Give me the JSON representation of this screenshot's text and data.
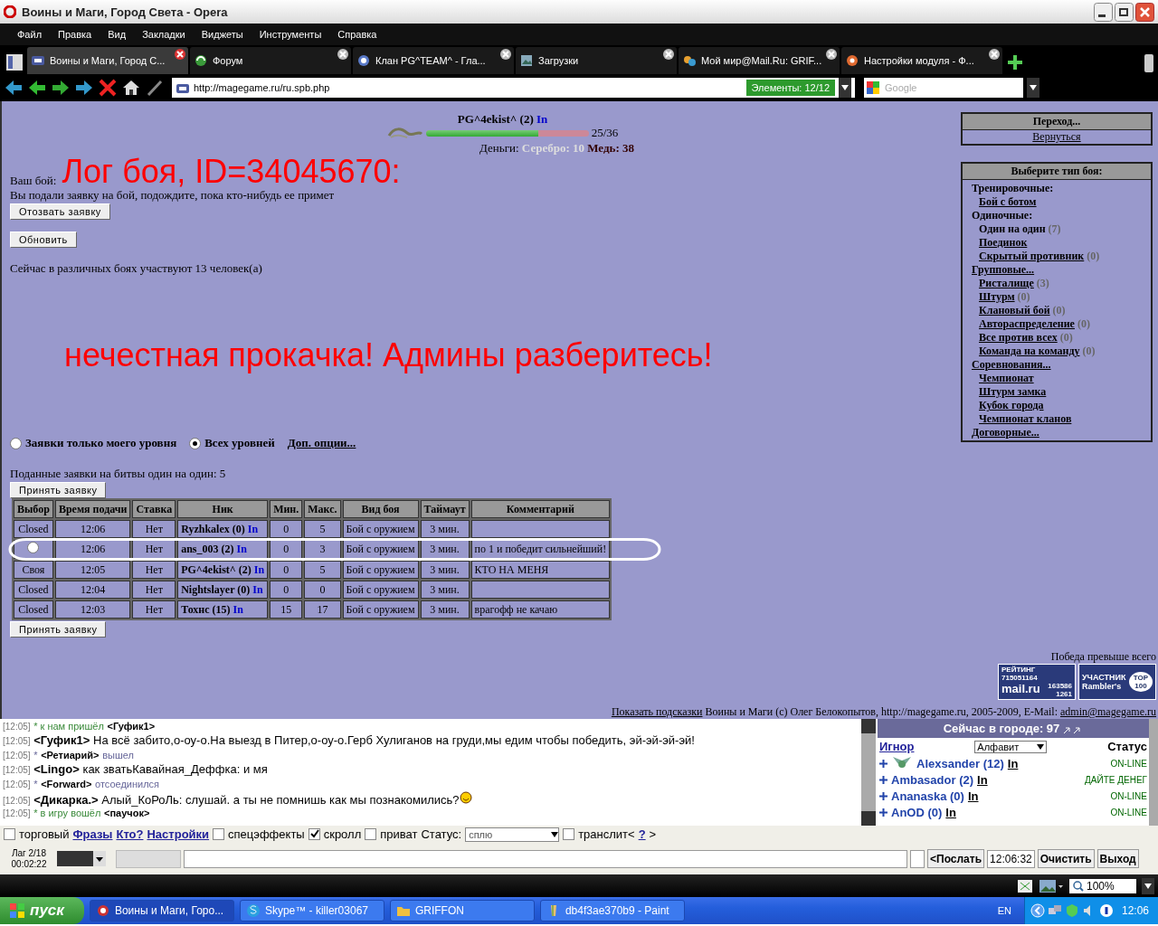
{
  "window": {
    "title": "Воины и Маги, Город Света - Opera"
  },
  "menu": [
    "Файл",
    "Правка",
    "Вид",
    "Закладки",
    "Виджеты",
    "Инструменты",
    "Справка"
  ],
  "tabs": [
    {
      "label": "Воины и Маги, Город С...",
      "selected": true
    },
    {
      "label": "Форум",
      "selected": false
    },
    {
      "label": "Клан PG^TEAM^ - Гла...",
      "selected": false
    },
    {
      "label": "Загрузки",
      "selected": false
    },
    {
      "label": "Мой мир@Mail.Ru: GRIF...",
      "selected": false
    },
    {
      "label": "Настройки модуля - Ф...",
      "selected": false
    }
  ],
  "address_bar": {
    "url": "http://magegame.ru/ru.spb.php",
    "elements": "Элементы:  12/12",
    "search_placeholder": "Google"
  },
  "game": {
    "player": {
      "name": "PG^4ekist^ (2)",
      "info_link": "In",
      "hp": {
        "level": 0.69,
        "reading": "25/36"
      },
      "money_label": "Деньги:",
      "silver": "Серебро: 10",
      "copper": "Медь: 38"
    },
    "your_fight_label": "Ваш бой:",
    "status": "Вы подали заявку на бой, подождите, пока кто-нибудь ее примет",
    "withdraw_button": "Отозвать заявку",
    "refresh_button": "Обновить",
    "participants": "Сейчас в различных боях участвуют 13 человек(а)",
    "annotations": [
      "Лог боя, ID=34045670:",
      "нечестная прокачка! Админы разберитесь!"
    ],
    "filters": [
      {
        "label": "Заявки только моего уровня",
        "selected": false
      },
      {
        "label": "Всех уровней",
        "selected": true
      }
    ],
    "options_link": "Доп. опции...",
    "requests_count": "Поданные заявки на битвы один на один: 5",
    "accept_buttons": [
      "Принять заявку",
      "Принять заявку"
    ],
    "table": {
      "columns": [
        "Выбор",
        "Время подачи",
        "Ставка",
        "Ник",
        "Мин.",
        "Макс.",
        "Вид боя",
        "Таймаут",
        "Комментарий"
      ],
      "rows": [
        {
          "choice": {
            "kind": "text",
            "text": "Closed"
          },
          "time": "12:06",
          "stake": "Нет",
          "nick": "Ryzhkalex (0)",
          "info": "In",
          "min": "0",
          "max": "5",
          "type": "Бой с оружием",
          "timeout": "3 мин.",
          "comment": ""
        },
        {
          "choice": {
            "kind": "radio",
            "selected": false
          },
          "time": "12:06",
          "stake": "Нет",
          "nick": "ans_003 (2)",
          "info": "In",
          "min": "0",
          "max": "3",
          "type": "Бой с оружием",
          "timeout": "3 мин.",
          "comment": "по 1 и победит сильнейший!"
        },
        {
          "choice": {
            "kind": "text",
            "text": "Своя"
          },
          "time": "12:05",
          "stake": "Нет",
          "nick": "PG^4ekist^ (2)",
          "info": "In",
          "min": "0",
          "max": "5",
          "type": "Бой с оружием",
          "timeout": "3 мин.",
          "comment": "КТО НА МЕНЯ"
        },
        {
          "choice": {
            "kind": "text",
            "text": "Closed"
          },
          "time": "12:04",
          "stake": "Нет",
          "nick": "Nightslayer (0)",
          "info": "In",
          "min": "0",
          "max": "0",
          "type": "Бой с оружием",
          "timeout": "3 мин.",
          "comment": ""
        },
        {
          "choice": {
            "kind": "text",
            "text": "Closed"
          },
          "time": "12:03",
          "stake": "Нет",
          "nick": "Тохнс (15)",
          "info": "In",
          "min": "15",
          "max": "17",
          "type": "Бой с оружием",
          "timeout": "3 мин.",
          "comment": "врагофф не качаю"
        }
      ]
    },
    "nav": {
      "title": "Переход...",
      "link": "Вернуться"
    },
    "fight_types": {
      "title": "Выберите тип боя:",
      "items": [
        {
          "label": "Тренировочные:",
          "kind": "text",
          "children": [
            {
              "label": "Бой с ботом",
              "kind": "link"
            }
          ]
        },
        {
          "label": "Одиночные:",
          "kind": "text",
          "children": [
            {
              "label": "Один на один",
              "kind": "text",
              "count": "(7)"
            },
            {
              "label": "Поединок",
              "kind": "link"
            },
            {
              "label": "Скрытый противник",
              "kind": "link",
              "count": "(0)"
            }
          ]
        },
        {
          "label": "Групповые...",
          "kind": "link",
          "children": [
            {
              "label": "Ристалище",
              "kind": "link",
              "count": "(3)"
            },
            {
              "label": "Штурм",
              "kind": "link",
              "count": "(0)"
            },
            {
              "label": "Клановый бой",
              "kind": "link",
              "count": "(0)"
            },
            {
              "label": "Автораспределение",
              "kind": "link",
              "count": "(0)"
            },
            {
              "label": "Все против всех",
              "kind": "link",
              "count": "(0)"
            },
            {
              "label": "Команда на команду",
              "kind": "link",
              "count": "(0)"
            }
          ]
        },
        {
          "label": "Соревнования...",
          "kind": "link",
          "children": [
            {
              "label": "Чемпионат",
              "kind": "link"
            },
            {
              "label": "Штурм замка",
              "kind": "link"
            },
            {
              "label": "Кубок города",
              "kind": "link"
            },
            {
              "label": "Чемпионат кланов",
              "kind": "link"
            }
          ]
        },
        {
          "label": "Договорные...",
          "kind": "link"
        }
      ]
    },
    "motto": "Победа превыше всего",
    "counters": {
      "rating_label": "РЕЙТИНГ",
      "rating_numbers": [
        "715051164",
        "163586",
        "1261"
      ],
      "rating_brand": "mail.ru",
      "top_label": "УЧАСТНИК",
      "top_brand": "Rambler's",
      "top_number": "TOP 100"
    },
    "footer": {
      "hints_link": "Показать подсказки",
      "copyright": "Воины и Маги (c) Олег Белокопытов, http://magegame.ru, 2005-2009, E-Mail:",
      "email": "admin@magegame.ru"
    }
  },
  "chat": {
    "messages": [
      {
        "time": "[12:05]",
        "kind": "join",
        "before": "* к нам пришёл",
        "nick": "<Гуфик1>"
      },
      {
        "time": "[12:05]",
        "kind": "say",
        "nick": "<Гуфик1>",
        "text": "На всё забито,о-оу-о.На выезд в Питер,о-оу-о.Герб Хулиганов на груди,мы едим чтобы победить, эй-эй-эй-эй!"
      },
      {
        "time": "[12:05]",
        "kind": "leave",
        "before": "*",
        "nick": "<Ретиарий>",
        "after": "вышел"
      },
      {
        "time": "[12:05]",
        "kind": "say",
        "nick": "<Lingo>",
        "text": "как зватьКавайная_Деффка: и мя"
      },
      {
        "time": "[12:05]",
        "kind": "leave",
        "before": "*",
        "nick": "<Forward>",
        "after": "отсоединился"
      },
      {
        "time": "[12:05]",
        "kind": "say",
        "nick": "<Дикарка.>",
        "text": "Алый_КоРоЛь: слушай. а ты не помнишь как мы познакомились?",
        "smiley": true
      },
      {
        "time": "[12:05]",
        "kind": "join",
        "before": "* в игру вошёл",
        "nick": "<паучок>"
      }
    ],
    "online": {
      "title": "Сейчас в городе: 97",
      "ignore": "Игнор",
      "sort": "Алфавит",
      "status_header": "Статус",
      "users": [
        {
          "name": "Alexsander (12)",
          "info": "In",
          "status": "ON-LINE",
          "badge": true
        },
        {
          "name": "Ambasador (2)",
          "info": "In",
          "status": "ДАЙТЕ ДЕНЕГ",
          "badge": false
        },
        {
          "name": "Ananaska (0)",
          "info": "In",
          "status": "ON-LINE",
          "badge": false
        },
        {
          "name": "AnOD (0)",
          "info": "In",
          "status": "ON-LINE",
          "badge": false
        }
      ]
    },
    "options": [
      {
        "kind": "check",
        "label": "торговый",
        "checked": false
      },
      {
        "kind": "link",
        "label": "Фразы"
      },
      {
        "kind": "link",
        "label": "Кто?"
      },
      {
        "kind": "link",
        "label": "Настройки"
      },
      {
        "kind": "check",
        "label": "спецэффекты",
        "checked": false
      },
      {
        "kind": "check",
        "label": "скролл",
        "checked": true
      },
      {
        "kind": "check",
        "label": "приват",
        "checked": false
      },
      {
        "kind": "select",
        "label": "Статус:",
        "value": "сплю"
      },
      {
        "kind": "check",
        "label": "транслит<",
        "checked": false
      },
      {
        "kind": "link",
        "label": "?"
      },
      {
        "kind": "text",
        "label": ">"
      }
    ],
    "lag": "Лаг 2/18",
    "session_time": "00:02:22",
    "send_button": "<Послать",
    "clock": "12:06:32",
    "clear_button": "Очистить",
    "exit_button": "Выход"
  },
  "status_bar": {
    "zoom": "100%"
  },
  "taskbar": {
    "start": "пуск",
    "tasks": [
      {
        "label": "Воины и Маги, Горо...",
        "selected": true
      },
      {
        "label": "Skype™ - killer03067",
        "selected": false
      },
      {
        "label": "GRIFFON",
        "selected": false
      },
      {
        "label": "db4f3ae370b9 - Paint",
        "selected": false
      }
    ],
    "language": "EN",
    "clock": "12:06"
  }
}
